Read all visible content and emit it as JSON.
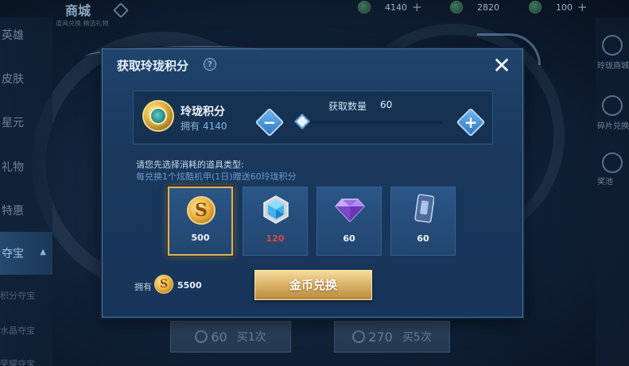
{
  "background": {
    "shop_title": "商城",
    "shop_subtitle": "道具兑换 精选礼物",
    "currencies": [
      {
        "value": "4140",
        "icon": "jade-coin-icon"
      },
      {
        "value": "2820",
        "icon": "token-coin-icon"
      },
      {
        "value": "100",
        "icon": "gem-coin-icon"
      }
    ],
    "side_nav": [
      "英雄",
      "皮肤",
      "星元",
      "礼物",
      "特惠",
      "夺宝"
    ],
    "side_sub": [
      "积分夺宝",
      "水晶夺宝",
      "荣耀夺宝"
    ],
    "right_nav": [
      "玲珑商城",
      "碎片兑换",
      "奖池"
    ],
    "bottom_buttons": [
      {
        "cost": "60",
        "action": "买1次"
      },
      {
        "cost": "270",
        "action": "买5次"
      }
    ]
  },
  "modal": {
    "title": "获取玲珑积分",
    "help_symbol": "?",
    "close_symbol": "✕",
    "points": {
      "name": "玲珑积分",
      "owned_label": "拥有",
      "owned_value": "4140"
    },
    "quantity": {
      "label": "获取数量",
      "value": "60",
      "minus_symbol": "−",
      "plus_symbol": "+",
      "slider_fraction": 0.0
    },
    "instruction_line1": "请您先选择消耗的道具类型:",
    "instruction_line2": "每兑换1个炫酷机甲(1日)赠送60玲珑积分",
    "items": [
      {
        "icon": "gold-coin-icon",
        "glyph": "S",
        "cost": "500",
        "selected": true,
        "cost_color": "#eef4fa"
      },
      {
        "icon": "hex-gem-icon",
        "cost": "120",
        "selected": false,
        "cost_color": "#e0483c"
      },
      {
        "icon": "diamond-icon",
        "cost": "60",
        "selected": false,
        "cost_color": "#eef4fa"
      },
      {
        "icon": "card-icon",
        "cost": "60",
        "selected": false,
        "cost_color": "#eef4fa"
      }
    ],
    "owned": {
      "label": "拥有",
      "coin_glyph": "S",
      "amount": "5500"
    },
    "exchange_button": "金币兑换"
  },
  "colors": {
    "modal_bg": "#1b3b60",
    "accent_gold": "#ddb56a",
    "accent_blue": "#5ea2dd",
    "warning_red": "#e0483c"
  }
}
